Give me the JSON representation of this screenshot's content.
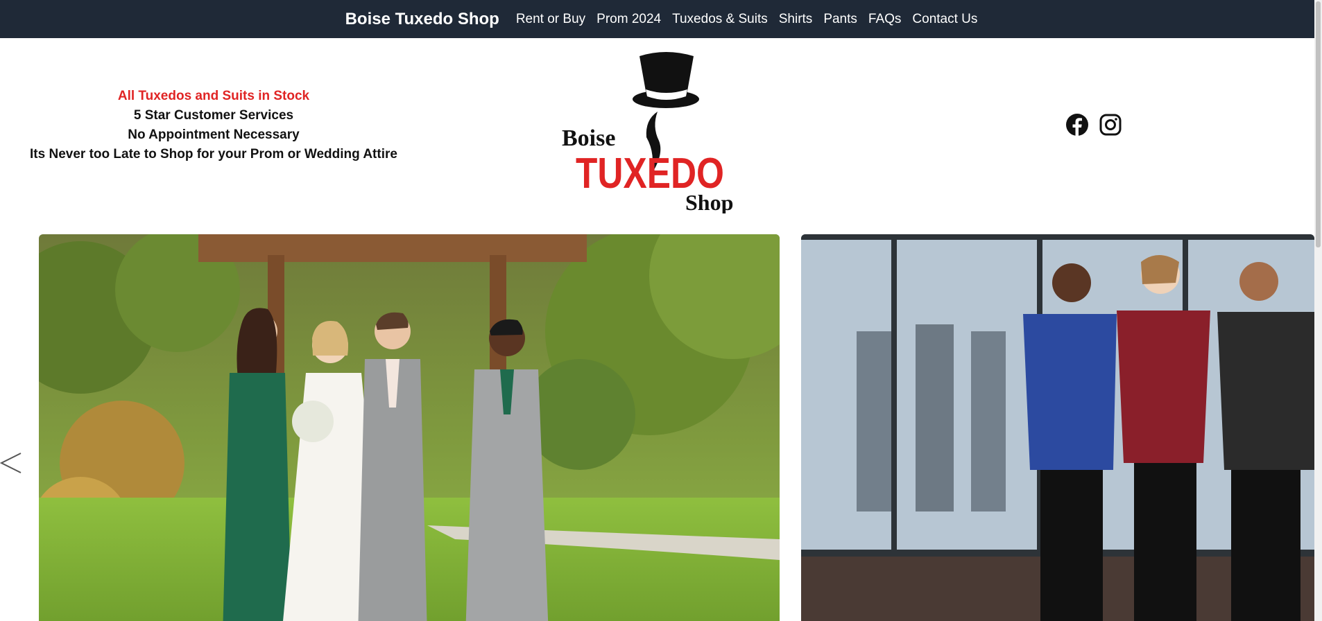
{
  "nav": {
    "brand": "Boise Tuxedo Shop",
    "links": [
      "Rent or Buy",
      "Prom 2024",
      "Tuxedos & Suits",
      "Shirts",
      "Pants",
      "FAQs",
      "Contact Us"
    ]
  },
  "taglines": {
    "highlight": "All Tuxedos and Suits in Stock",
    "line2": "5 Star Customer Services",
    "line3": "No Appointment Necessary",
    "line4": "Its Never too Late to Shop for your Prom or Wedding Attire"
  },
  "logo": {
    "word1": "Boise",
    "word2": "TUXEDO",
    "word3": "Shop"
  },
  "socials": [
    "facebook-icon",
    "instagram-icon"
  ],
  "carousel": {
    "slides": [
      "wedding-party-photo",
      "prom-tuxedos-photo"
    ],
    "prev_icon": "chevron-left-icon"
  },
  "colors": {
    "nav_bg": "#1f2937",
    "accent_red": "#e02424",
    "text": "#111111"
  }
}
